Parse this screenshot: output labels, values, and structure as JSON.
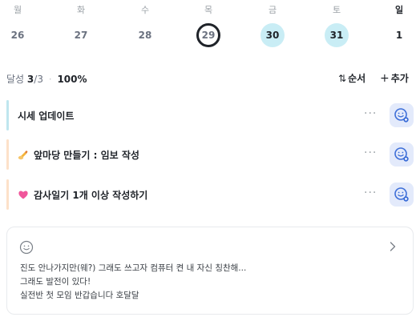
{
  "week": [
    {
      "dow": "월",
      "date": "26",
      "state": "plain"
    },
    {
      "dow": "화",
      "date": "27",
      "state": "plain"
    },
    {
      "dow": "수",
      "date": "28",
      "state": "plain"
    },
    {
      "dow": "목",
      "date": "29",
      "state": "today"
    },
    {
      "dow": "금",
      "date": "30",
      "state": "done"
    },
    {
      "dow": "토",
      "date": "31",
      "state": "done"
    },
    {
      "dow": "일",
      "date": "1",
      "state": "plain-dark"
    }
  ],
  "progress": {
    "label": "달성",
    "done": "3",
    "total_text": "/3",
    "separator": "·",
    "percent": "100%"
  },
  "controls": {
    "sort_label": "순서",
    "add_label": "추가"
  },
  "tasks": [
    {
      "title": "시세 업데이트",
      "accent": "#bfe6ee",
      "icon": "none"
    },
    {
      "title": "앞마당 만들기 : 임보 작성",
      "accent": "#fde1c9",
      "icon": "writing-hand"
    },
    {
      "title": "감사일기 1개 이상 작성하기",
      "accent": "#fde1c9",
      "icon": "pink-heart"
    }
  ],
  "more_label": "···",
  "memo": {
    "lines": [
      "진도 안나가지만(웨?) 그래도 쓰고자 컴퓨터 켠 내 자신 칭찬해...",
      "그래도 발전이 있다!",
      "실전반 첫 모임 반갑습니다 호달달"
    ]
  },
  "colors": {
    "accent_done": "#c9edf5",
    "react_bg": "#e3eafb",
    "react_icon": "#3e6fd8"
  }
}
